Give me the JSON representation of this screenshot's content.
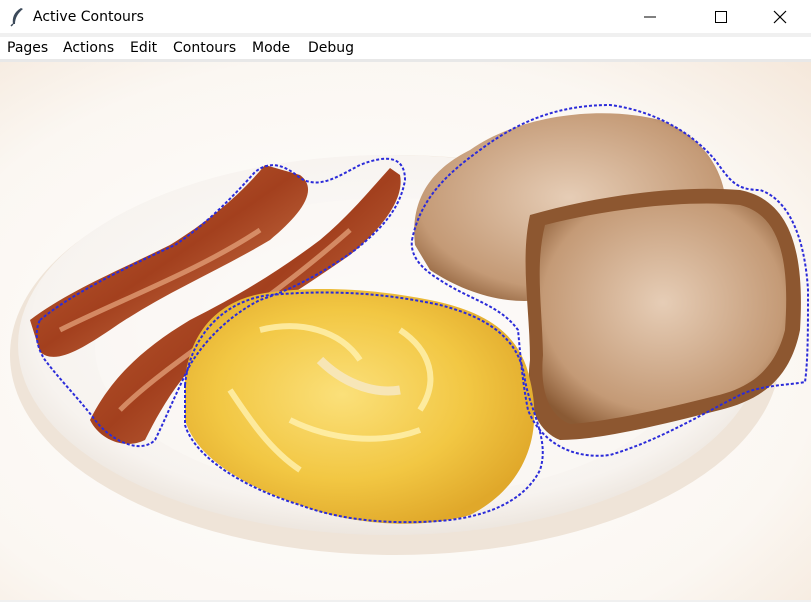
{
  "window": {
    "title": "Active Contours",
    "controls": {
      "minimize_icon": "minimize-icon",
      "maximize_icon": "maximize-icon",
      "close_icon": "close-icon"
    }
  },
  "menu": {
    "items": [
      {
        "label": "Pages"
      },
      {
        "label": "Actions"
      },
      {
        "label": "Edit"
      },
      {
        "label": "Contours"
      },
      {
        "label": "Mode"
      },
      {
        "label": "Debug"
      }
    ]
  },
  "canvas": {
    "image_description_icon": "breakfast-plate-image",
    "contour_color": "#2b2bd9",
    "contours": [
      "bacon-contour",
      "egg-contour",
      "toast-contour"
    ]
  },
  "colors": {
    "titlebar_bg": "#ffffff",
    "menubar_bg": "#ffffff",
    "contour": "#2b2bd9"
  }
}
